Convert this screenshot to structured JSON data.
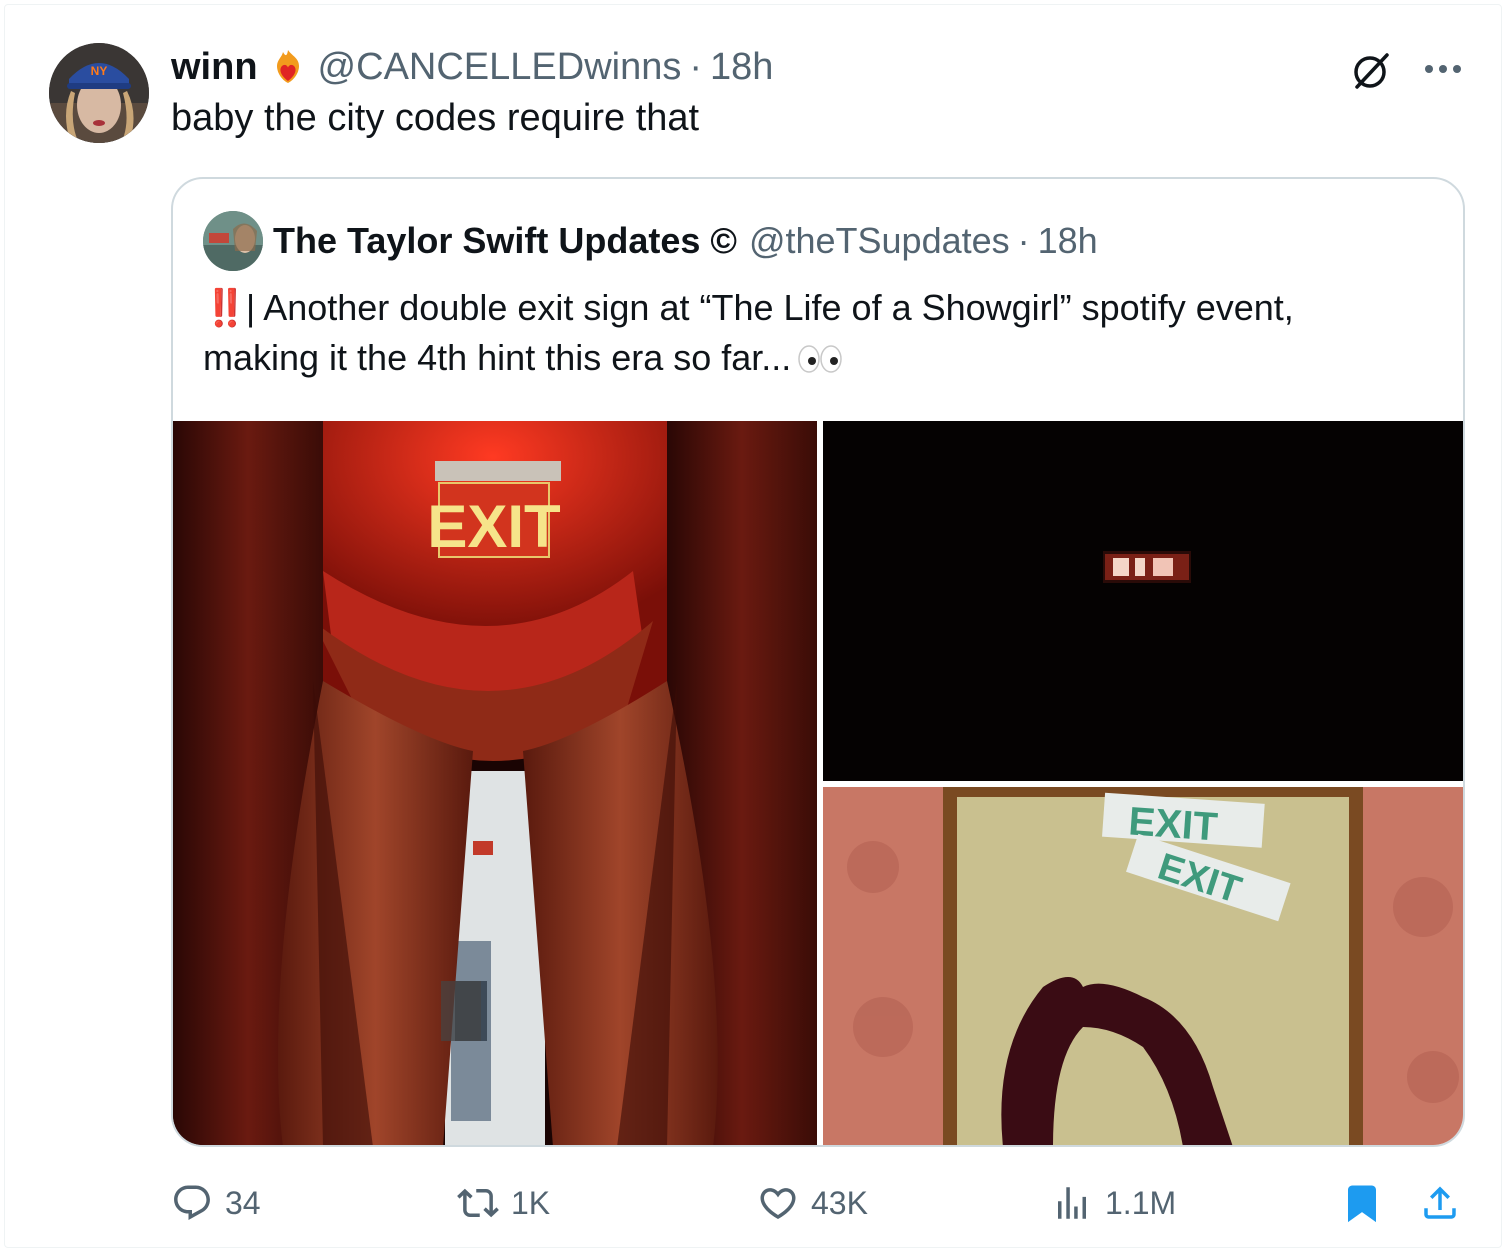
{
  "tweet": {
    "display_name": "winn",
    "handle": "@CANCELLEDwinns",
    "separator": "·",
    "time": "18h",
    "text": "baby the city codes require that"
  },
  "quoted": {
    "display_name": "The Taylor Swift Updates",
    "symbol": "©",
    "handle": "@theTSupdates",
    "separator": "·",
    "time": "18h",
    "alert": "‼️",
    "text_line1": "| Another double exit sign at “The Life of a Showgirl” spotify event,",
    "text_line2": "making it the 4th hint this era so far...",
    "images": [
      {
        "sign_text": "EXIT"
      },
      {
        "sign_text": ""
      },
      {
        "sign_text": "EXIT",
        "sign_text_2": "EXIT"
      }
    ]
  },
  "actions": {
    "replies": "34",
    "reposts": "1K",
    "likes": "43K",
    "views": "1.1M"
  },
  "colors": {
    "text_primary": "#0f1419",
    "text_secondary": "#536471",
    "bookmark_active": "#1d9bf0",
    "border": "#cfd9de"
  },
  "icons": {
    "reply": "reply-icon",
    "repost": "repost-icon",
    "like": "heart-icon",
    "views": "views-icon",
    "bookmark": "bookmark-icon",
    "share": "share-icon",
    "grok": "grok-icon",
    "more": "more-icon"
  }
}
